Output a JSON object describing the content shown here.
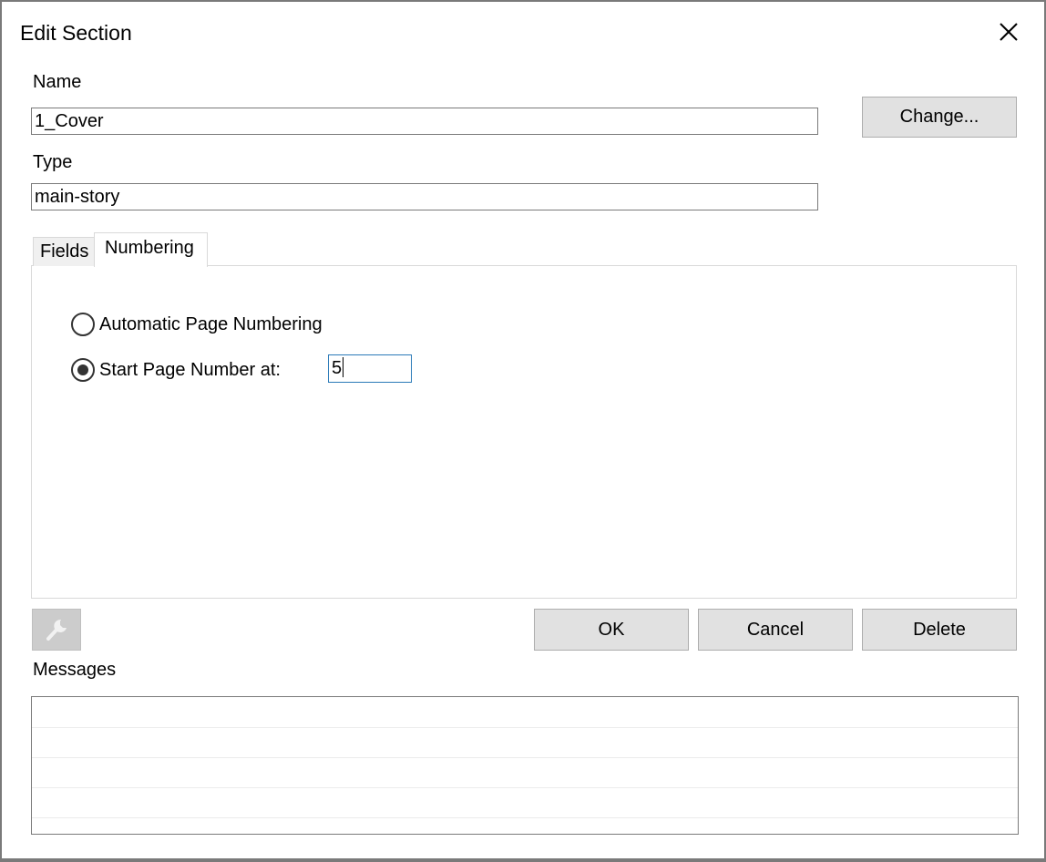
{
  "dialog": {
    "title": "Edit Section",
    "close_icon": "close-icon"
  },
  "name_field": {
    "label": "Name",
    "value": "1_Cover"
  },
  "change_button": {
    "label": "Change..."
  },
  "type_field": {
    "label": "Type",
    "value": "main-story"
  },
  "tabs": [
    {
      "label": "Fields",
      "selected": false
    },
    {
      "label": "Numbering",
      "selected": true
    }
  ],
  "numbering": {
    "options": [
      {
        "label": "Automatic Page Numbering",
        "selected": false
      },
      {
        "label": "Start Page Number at:",
        "selected": true
      }
    ],
    "start_value": "5"
  },
  "toolbar": {
    "tool_icon": "wrench-icon",
    "tool_enabled": false
  },
  "buttons": {
    "ok": "OK",
    "cancel": "Cancel",
    "delete": "Delete"
  },
  "messages": {
    "label": "Messages",
    "items": []
  },
  "colors": {
    "button_bg": "#e1e1e1",
    "focus_border": "#2a7ab8",
    "disabled_button_bg": "#cccccc"
  }
}
